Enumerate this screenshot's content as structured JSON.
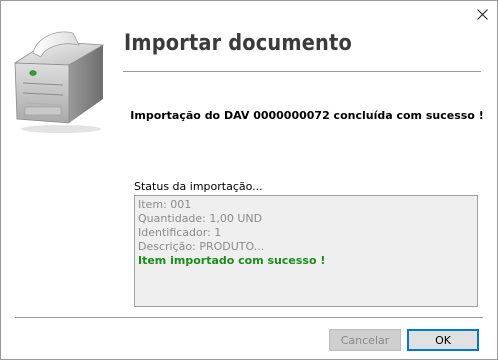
{
  "dialog": {
    "title": "Importar documento",
    "message": "Importação do DAV 0000000072 concluída com sucesso !",
    "close_icon": "close-icon",
    "printer_icon": "printer-icon"
  },
  "status": {
    "label": "Status da importação...",
    "lines": [
      "Item: 001",
      "Quantidade: 1,00 UND",
      "Identificador: 1",
      "Descrição: PRODUTO..."
    ],
    "success_line": "Item importado com sucesso !",
    "success_color": "#1a8c1a"
  },
  "buttons": {
    "cancel_label": "Cancelar",
    "ok_label": "OK",
    "accent_color": "#0078d7"
  }
}
